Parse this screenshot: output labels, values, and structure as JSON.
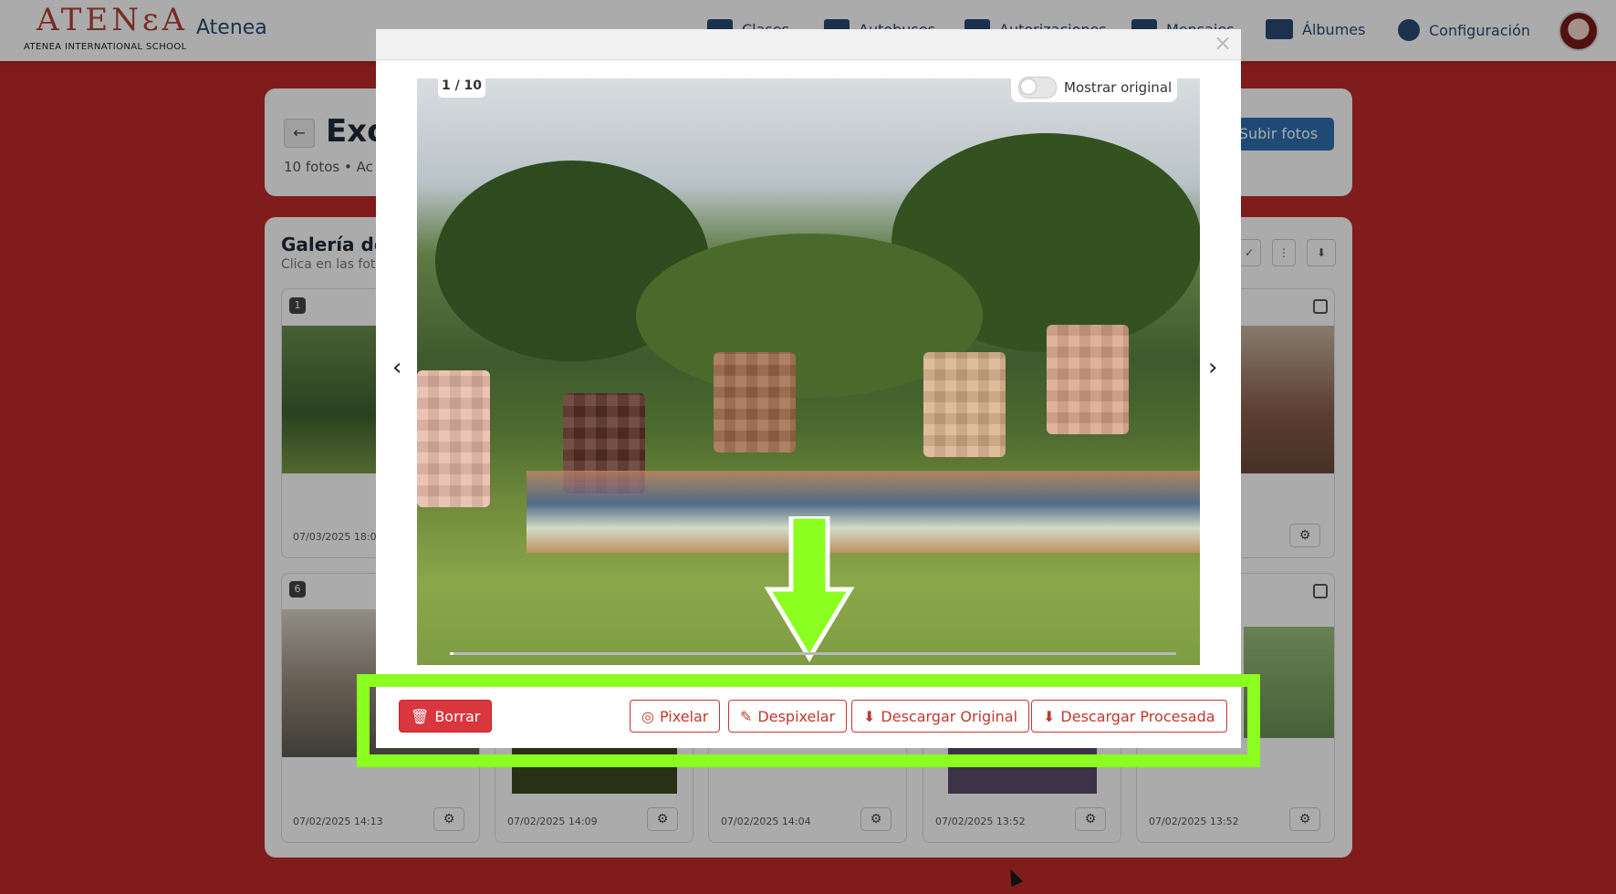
{
  "header": {
    "logo_text": "ATENεA",
    "logo_subtitle": "ATENEA INTERNATIONAL SCHOOL",
    "brand": "Atenea",
    "nav": [
      "Clases",
      "Autobuses",
      "Autorizaciones",
      "Mensajes",
      "Álbumes",
      "Configuración"
    ]
  },
  "album": {
    "back_glyph": "←",
    "title": "Exc",
    "meta": "10 fotos • Ac",
    "upload_label": "Subir fotos"
  },
  "gallery": {
    "title": "Galería de",
    "subtitle": "Clica en las foto",
    "tiles_row1": [
      {
        "num": "1",
        "date": "07/03/2025 18:0"
      }
    ],
    "tiles_row2": [
      {
        "num": "6",
        "date": "07/02/2025 14:13"
      },
      {
        "num": "",
        "date": "07/02/2025 14:09"
      },
      {
        "num": "",
        "date": "07/02/2025 14:04"
      },
      {
        "num": "",
        "date": "07/02/2025 13:52"
      },
      {
        "num": "",
        "date": "07/02/2025 13:52"
      }
    ]
  },
  "viewer": {
    "close_glyph": "×",
    "counter": "1 / 10",
    "toggle_label": "Mostrar original",
    "toggle_on": false,
    "prev_glyph": "‹",
    "next_glyph": "›"
  },
  "footer": {
    "delete_label": "Borrar",
    "pixelate_label": "Pixelar",
    "unpixelate_label": "Despixelar",
    "download_original_label": "Descargar Original",
    "download_processed_label": "Descargar Procesada"
  },
  "icons": {
    "delete": "trash-icon",
    "pixelate": "eye-slash-icon",
    "unpixelate": "magic-wand-icon",
    "download": "download-icon"
  },
  "colors": {
    "background": "#bf2a2a",
    "highlight": "#8bff1f",
    "danger": "#d9363e",
    "primary": "#2f6fb0",
    "nav_text": "#2b4a73"
  }
}
